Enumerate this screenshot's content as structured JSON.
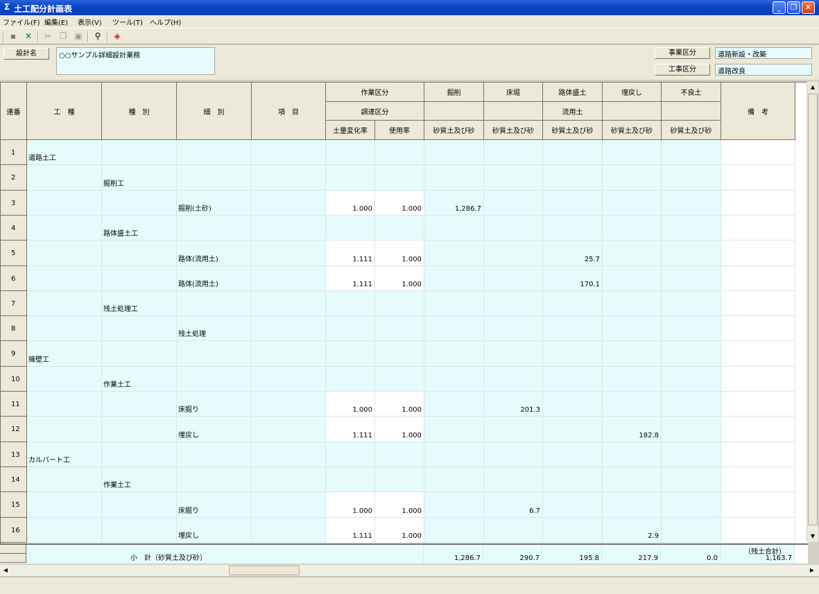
{
  "window": {
    "title": "土工配分計画表"
  },
  "menu": [
    "ファイル(F)",
    "編集(E)",
    "表示(V)",
    "ツール(T)",
    "ヘルプ(H)"
  ],
  "toolbar": {
    "icons": [
      "save-icon",
      "excel-icon",
      "cut-icon",
      "copy-icon",
      "paste-icon",
      "find-icon",
      "book-icon"
    ]
  },
  "header": {
    "design_name_label": "設計名",
    "design_name_value": "○○サンプル詳細設計業務",
    "business_label": "事業区分",
    "business_value": "道路新設・改築",
    "construction_label": "工事区分",
    "construction_value": "道路改良"
  },
  "columns": {
    "no": "連番",
    "koushu": "工　種",
    "shubetsu": "種　別",
    "saibetsu": "細　別",
    "koumoku": "項　目",
    "sagyou_kubun": "作業区分",
    "choutatsu_kubun": "調達区分",
    "dosuryo": "土量変化率",
    "shiyouritsu": "使用率",
    "kussaku": "掘削",
    "tokobori": "床堀",
    "rotai": "路体盛土",
    "ryuyo": "流用土",
    "umemodoshi": "埋戻し",
    "furyodo": "不良土",
    "sand": "砂質土及び砂",
    "bikou": "備　考"
  },
  "rows": [
    {
      "no": "1",
      "koushu": "道路土工",
      "shubetsu": "",
      "saibetsu": "",
      "dosuryo": "",
      "shiyouritsu": "",
      "kussaku": "",
      "tokobori": "",
      "rotai": "",
      "umemodoshi": "",
      "furyodo": ""
    },
    {
      "no": "2",
      "koushu": "",
      "shubetsu": "掘削工",
      "saibetsu": "",
      "dosuryo": "",
      "shiyouritsu": "",
      "kussaku": "",
      "tokobori": "",
      "rotai": "",
      "umemodoshi": "",
      "furyodo": ""
    },
    {
      "no": "3",
      "koushu": "",
      "shubetsu": "",
      "saibetsu": "掘削(土砂)",
      "dosuryo": "1.000",
      "shiyouritsu": "1.000",
      "kussaku": "1,286.7",
      "tokobori": "",
      "rotai": "",
      "umemodoshi": "",
      "furyodo": ""
    },
    {
      "no": "4",
      "koushu": "",
      "shubetsu": "路体盛土工",
      "saibetsu": "",
      "dosuryo": "",
      "shiyouritsu": "",
      "kussaku": "",
      "tokobori": "",
      "rotai": "",
      "umemodoshi": "",
      "furyodo": ""
    },
    {
      "no": "5",
      "koushu": "",
      "shubetsu": "",
      "saibetsu": "路体(流用土)",
      "dosuryo": "1.111",
      "shiyouritsu": "1.000",
      "kussaku": "",
      "tokobori": "",
      "rotai": "25.7",
      "umemodoshi": "",
      "furyodo": ""
    },
    {
      "no": "6",
      "koushu": "",
      "shubetsu": "",
      "saibetsu": "路体(流用土)",
      "dosuryo": "1.111",
      "shiyouritsu": "1.000",
      "kussaku": "",
      "tokobori": "",
      "rotai": "170.1",
      "umemodoshi": "",
      "furyodo": ""
    },
    {
      "no": "7",
      "koushu": "",
      "shubetsu": "残土処理工",
      "saibetsu": "",
      "dosuryo": "",
      "shiyouritsu": "",
      "kussaku": "",
      "tokobori": "",
      "rotai": "",
      "umemodoshi": "",
      "furyodo": ""
    },
    {
      "no": "8",
      "koushu": "",
      "shubetsu": "",
      "saibetsu": "残土処理",
      "dosuryo": "",
      "shiyouritsu": "",
      "kussaku": "",
      "tokobori": "",
      "rotai": "",
      "umemodoshi": "",
      "furyodo": ""
    },
    {
      "no": "9",
      "koushu": "擁壁工",
      "shubetsu": "",
      "saibetsu": "",
      "dosuryo": "",
      "shiyouritsu": "",
      "kussaku": "",
      "tokobori": "",
      "rotai": "",
      "umemodoshi": "",
      "furyodo": ""
    },
    {
      "no": "10",
      "koushu": "",
      "shubetsu": "作業土工",
      "saibetsu": "",
      "dosuryo": "",
      "shiyouritsu": "",
      "kussaku": "",
      "tokobori": "",
      "rotai": "",
      "umemodoshi": "",
      "furyodo": ""
    },
    {
      "no": "11",
      "koushu": "",
      "shubetsu": "",
      "saibetsu": "床掘り",
      "dosuryo": "1.000",
      "shiyouritsu": "1.000",
      "kussaku": "",
      "tokobori": "201.3",
      "rotai": "",
      "umemodoshi": "",
      "furyodo": ""
    },
    {
      "no": "12",
      "koushu": "",
      "shubetsu": "",
      "saibetsu": "埋戻し",
      "dosuryo": "1.111",
      "shiyouritsu": "1.000",
      "kussaku": "",
      "tokobori": "",
      "rotai": "",
      "umemodoshi": "182.8",
      "furyodo": ""
    },
    {
      "no": "13",
      "koushu": "カルバート工",
      "shubetsu": "",
      "saibetsu": "",
      "dosuryo": "",
      "shiyouritsu": "",
      "kussaku": "",
      "tokobori": "",
      "rotai": "",
      "umemodoshi": "",
      "furyodo": ""
    },
    {
      "no": "14",
      "koushu": "",
      "shubetsu": "作業土工",
      "saibetsu": "",
      "dosuryo": "",
      "shiyouritsu": "",
      "kussaku": "",
      "tokobori": "",
      "rotai": "",
      "umemodoshi": "",
      "furyodo": ""
    },
    {
      "no": "15",
      "koushu": "",
      "shubetsu": "",
      "saibetsu": "床掘り",
      "dosuryo": "1.000",
      "shiyouritsu": "1.000",
      "kussaku": "",
      "tokobori": "6.7",
      "rotai": "",
      "umemodoshi": "",
      "furyodo": ""
    },
    {
      "no": "16",
      "koushu": "",
      "shubetsu": "",
      "saibetsu": "埋戻し",
      "dosuryo": "1.111",
      "shiyouritsu": "1.000",
      "kussaku": "",
      "tokobori": "",
      "rotai": "",
      "umemodoshi": "2.9",
      "furyodo": ""
    }
  ],
  "footer": {
    "label": "小　計（砂質土及び砂）",
    "kussaku": "1,286.7",
    "tokobori": "290.7",
    "rotai": "195.8",
    "umemodoshi": "217.9",
    "furyodo": "0.0",
    "bikou_label": "（残土合計）",
    "bikou_value": "1,163.7"
  },
  "colors": {
    "cell_cyan": "#e6fcfc",
    "titlebar": "#0a46c8",
    "header_gray": "#ece9d8"
  }
}
